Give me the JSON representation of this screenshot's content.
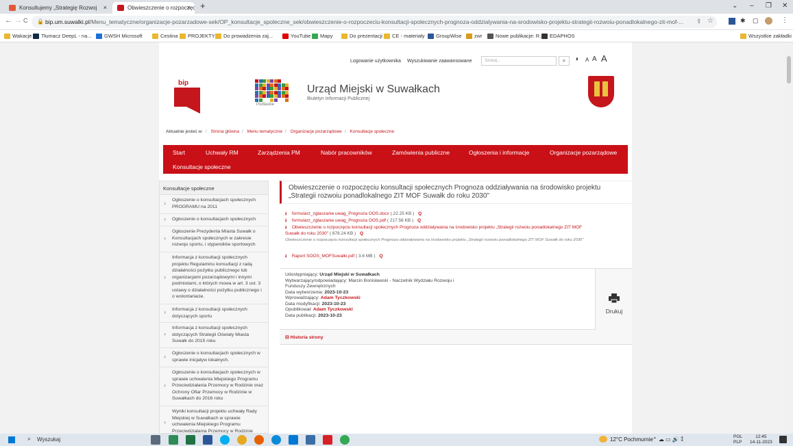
{
  "tabs": [
    {
      "label": "Konsultujemy „Strategię Rozwoj",
      "close": "×",
      "fav_color": "#e05a3a"
    },
    {
      "label": "Obwieszczenie o rozpoczęciu k",
      "close": "×",
      "fav_color": "#c4161c"
    }
  ],
  "new_tab": "+",
  "window_controls": {
    "menu": "⌄",
    "minimize": "–",
    "restore": "❐",
    "close": "✕"
  },
  "nav": {
    "back": "←",
    "forward": "→",
    "reload": "C"
  },
  "url": {
    "domain": "bip.um.suwalki.pl",
    "path": "/Menu_tematyczne/organizacje-pozarzadowe-sek/OP_konsultacje_spoleczne_sek/obwieszczenie-o-rozpoczeciu-konsultacji-spolecznych-prognoza-oddzialywania-na-srodowisko-projektu-strategii-rozwoiu-ponadlokalnego-zit-mof-..."
  },
  "bookmarks": [
    {
      "label": "Wakacje",
      "color": "#e9b730"
    },
    {
      "label": "Tłumacz DeepL - na...",
      "color": "#0f2b46"
    },
    {
      "label": "GWSH Microsoft",
      "color": "#1e6fd9"
    },
    {
      "label": "Cestina",
      "color": "#e9b730"
    },
    {
      "label": "PROJEKTY",
      "color": "#e9b730"
    },
    {
      "label": "Do prowadzenia zaj...",
      "color": "#e9b730"
    },
    {
      "label": "YouTube",
      "color": "#e00000"
    },
    {
      "label": "Mapy",
      "color": "#34a853"
    },
    {
      "label": "Do prezentacji",
      "color": "#e9b730"
    },
    {
      "label": "CE - materiały",
      "color": "#e9b730"
    },
    {
      "label": "GroupWise",
      "color": "#2b5797"
    },
    {
      "label": "zwr",
      "color": "#d99b1c"
    },
    {
      "label": "Nowe publikacje: R...",
      "color": "#555555"
    },
    {
      "label": "EDAPHOS",
      "color": "#333333"
    }
  ],
  "bookmarks_all": "Wszystkie zakładki",
  "site": {
    "login": "Logowanie użytkownika",
    "advanced_search": "Wyszukiwanie zaawansowane",
    "search_placeholder": "Szukaj...",
    "search_icon": "⌕",
    "contrast_icon": "◑",
    "font_sizes": [
      "A",
      "A",
      "A"
    ],
    "blp": "bip",
    "podlaskie": "Podlaskie",
    "title": "Urząd Miejski w Suwałkach",
    "subtitle": "Biuletyn Informacji Publicznej"
  },
  "breadcrumb": {
    "prefix": "Aktualnie jesteś w:",
    "sep": "/",
    "items": [
      "Strona główna",
      "Menu tematyczne",
      "Organizacje pozarządowe",
      "Konsultacje społeczne"
    ]
  },
  "menu": [
    "Start",
    "Uchwały RM",
    "Zarządzenia PM",
    "Nabór pracowników",
    "Zamówienia publiczne",
    "Ogłoszenia i informacje",
    "Organizacje pozarządowe",
    "Konsultacje społeczne"
  ],
  "sidebar": {
    "heading": "Konsultacje społeczne",
    "items": [
      "Ogłoszenie o konsultacjach społecznych PROGRAMU na 2011",
      "Ogłoszenie o konsultacjach społecznych",
      "Ogłoszenie Prezydenta Miasta Suwałk o Konsultacjach społecznych w zakresie rozwoju sportu, i stypendiów sportowych",
      "Informacja z konsultacji społecznych projektu Regulaminu konsultacji z radą działalności pożytku publicznego lub organizacjami pozarządowymi i innymi podmiotami, o których mowa w art. 3 ust. 3 ustawy o działalności pożytku publicznego i o wolontariacie.",
      "Informacja z konsultacji społecznych dotyczących sportu",
      "Informacja z konsultacji społecznych dotyczących Strategii Oświaty Miasta Suwałk do 2015 roku",
      "Ogłoszenie o konsultacjach społecznych w sprawie inicjatyw lokalnych.",
      "Ogłoszenie o konsultacjach społecznych w sprawie uchwalenia Miejskiego Programu Przeciwdziałania Przemocy w Rodzinie oraz Ochrony Ofiar Przemocy w Rodzinie w Suwałkach do 2016 roku",
      "Wyniki konsultacji projektu uchwały Rady Miejskiej w Suwałkach w sprawie uchwalenia Miejskiego Programu Przeciwdziałania Przemocy w Rodzinie"
    ]
  },
  "article": {
    "title": "Obwieszczenie o rozpoczęciu konsultacji społecznych Prognoza oddziaływania na środowisko projektu „Strategii rozwoiu ponadlokalnego ZIT MOF Suwałk do roku 2030\"",
    "download_icon": "⭳",
    "preview_icon": "Q",
    "attachments": [
      {
        "name": "formularz_zgłaszanie uwag_Prognoza OOS.docx",
        "size": "( 22.25 KB )"
      },
      {
        "name": "formularz_zgłaszanie uwag_Prognoza OOS.pdf",
        "size": "( 217.56 KB )"
      },
      {
        "name": "Obwieszczenie o rozpoczęciu konsultacji społecznych Prognoza oddziaływania na środowisko projektu „Strategii rozwoiu ponadlokalnego ZIT MOF",
        "name2": "Suwałk do roku 2030\"",
        "size": "( 878.24 KB )"
      },
      {
        "name": "Raport SOOS_MOFSuwałki.pdf",
        "size": "( 3.6 MB )"
      }
    ],
    "attachment_desc": "Obwieszczenie o rozpoczęciu konsultacji społecznych Prognoza oddziaływania na środowisko projektu „Strategii rozwoiu ponadlokalnego ZIT MOF Suwałk do roku 2030\"",
    "meta": {
      "provider_label": "Udostępniający:",
      "provider": "Urząd Miejski w Suwałkach",
      "producer_label": "Wytwarzający/odpowiadający:",
      "producer": "Marcin Bonisławski - Naczelnik Wydziału Rozwoju i",
      "producer2": "Funduszy Zewnętrznych",
      "created_label": "Data wytworzenia:",
      "created": "2023-10-23",
      "entered_label": "Wprowadzający:",
      "entered": "Adam Tyczkowski",
      "modified_label": "Data modyfikacji:",
      "modified": "2023-10-23",
      "published_by_label": "Opublikował:",
      "published_by": "Adam Tyczkowski",
      "published_label": "Data publikacji:",
      "published": "2023-10-23"
    },
    "print_label": "Drukuj",
    "history": "⊟ Historia strony"
  },
  "taskbar": {
    "search": "Wyszukaj",
    "weather": "12°C Pochmurnie",
    "lang1": "POL",
    "lang2": "PLP",
    "time": "12:45",
    "date": "14-11-2023"
  }
}
